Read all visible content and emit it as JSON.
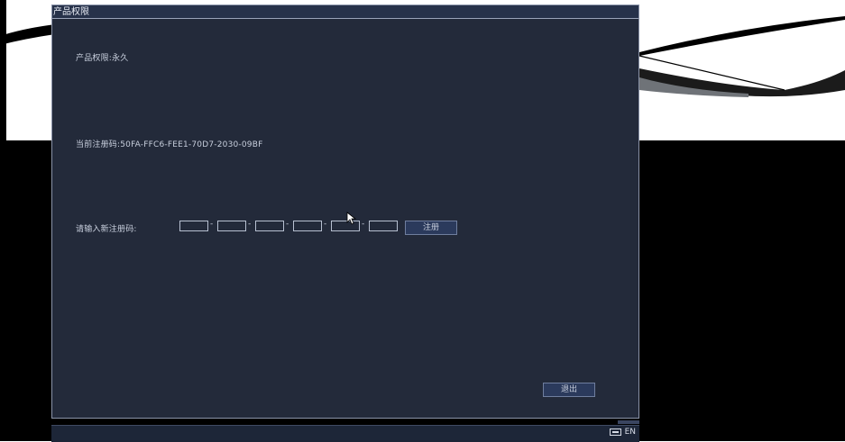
{
  "window": {
    "title": "产品权限",
    "license_text": "产品权限:永久",
    "current_code_text": "当前注册码:50FA-FFC6-FEE1-70D7-2030-09BF",
    "input_label": "请输入新注册码:",
    "register_button": "注册",
    "exit_button": "退出",
    "code_fields": [
      "",
      "",
      "",
      "",
      "",
      ""
    ],
    "separator": "-"
  },
  "taskbar": {
    "language": "EN"
  }
}
